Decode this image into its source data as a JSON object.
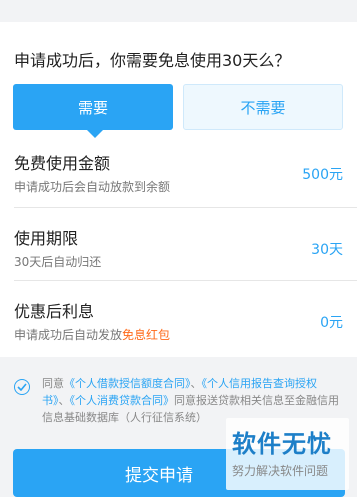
{
  "question": "申请成功后，你需要免息使用30天么？",
  "options": {
    "yes": "需要",
    "no": "不需要"
  },
  "rows": [
    {
      "label": "免费使用金额",
      "sub": "申请成功后会自动放款到余额",
      "sub_highlight": "",
      "value": "500元"
    },
    {
      "label": "使用期限",
      "sub": "30天后自动归还",
      "sub_highlight": "",
      "value": "30天"
    },
    {
      "label": "优惠后利息",
      "sub": "申请成功后自动发放",
      "sub_highlight": "免息红包",
      "value": "0元"
    }
  ],
  "agreement": {
    "prefix": "同意",
    "link1": "《个人借款授信额度合同》",
    "sep1": "、",
    "link2": "《个人信用报告查询授权书》",
    "sep2": "、",
    "link3": "《个人消费贷款合同》",
    "suffix": "同意报送贷款相关信息至金融信用信息基础数据库（人行征信系统）"
  },
  "submit_label": "提交申请",
  "watermark": {
    "title": "软件无忧",
    "subtitle": "努力解决软件问题"
  },
  "colors": {
    "accent": "#2aa4f4",
    "highlight": "#ff6a1a"
  },
  "icons": {
    "check": "check-circle-icon"
  }
}
